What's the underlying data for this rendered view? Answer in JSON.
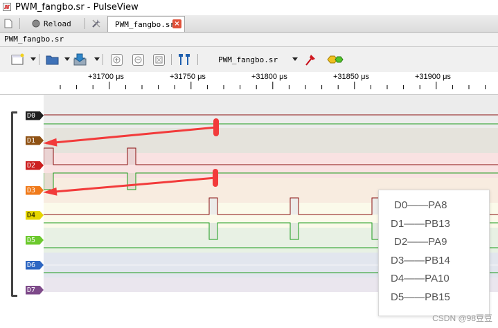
{
  "window": {
    "title": "PWM_fangbo.sr - PulseView"
  },
  "tabbar": {
    "reload_label": "Reload",
    "active_tab_label": "PWM_fangbo.sr",
    "close_glyph": "×"
  },
  "document": {
    "label": "PWM_fangbo.sr"
  },
  "toolbar": {
    "session_select_value": "PWM_fangbo.sr"
  },
  "ruler": {
    "ticks": [
      "+31700 μs",
      "+31750 μs",
      "+31800 μs",
      "+31850 μs",
      "+31900 μs"
    ]
  },
  "channels": [
    {
      "label": "D0",
      "color": "#1e1e1e"
    },
    {
      "label": "D1",
      "color": "#8f5214"
    },
    {
      "label": "D2",
      "color": "#cc1f1f"
    },
    {
      "label": "D3",
      "color": "#f07a1a"
    },
    {
      "label": "D4",
      "color": "#e6d600"
    },
    {
      "label": "D5",
      "color": "#6cc92d"
    },
    {
      "label": "D6",
      "color": "#2d66c2"
    },
    {
      "label": "D7",
      "color": "#7e4a8a"
    }
  ],
  "pin_map": [
    "D0——PA8",
    "D1——PB13",
    "D2——PA9",
    "D3——PB14",
    "D4——PA10",
    "D5——PB15"
  ],
  "watermark": "CSDN @98豆豆",
  "colors": {
    "wave_high": "#8a0f0f",
    "wave_low": "#1a9a1a",
    "annotation_arrow": "#f23b3b"
  }
}
